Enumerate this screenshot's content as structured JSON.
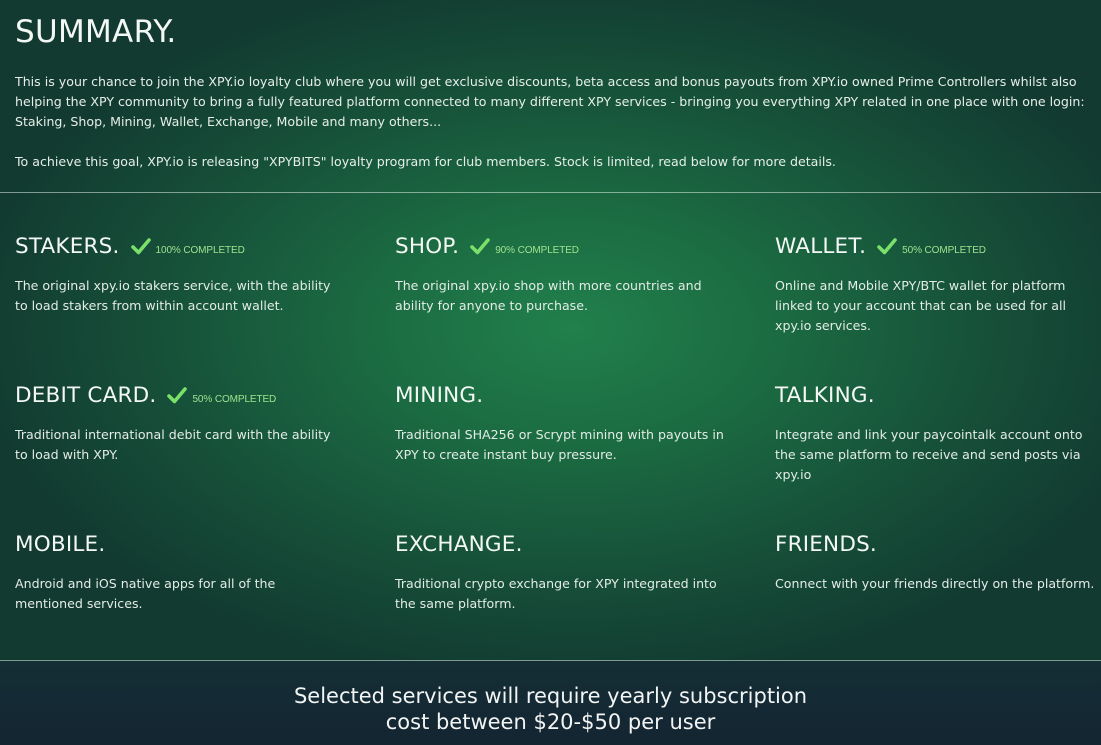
{
  "summary": {
    "title": "SUMMARY.",
    "paragraph1": "This is your chance to join the XPY.io loyalty club where you will get exclusive discounts, beta access and bonus payouts from XPY.io owned Prime Controllers whilst also helping the XPY community to bring a fully featured platform connected to many different XPY services - bringing you everything XPY related in one place with one login: Staking, Shop, Mining, Wallet, Exchange, Mobile and many others...",
    "paragraph2": "To achieve this goal, XPY.io is releasing \"XPYBITS\" loyalty program for club members. Stock is limited, read below for more details."
  },
  "services": [
    {
      "title": "STAKERS.",
      "badge": "100% COMPLETED",
      "progress_percent": 100,
      "icon": "check-icon",
      "description": "The original xpy.io stakers service, with the ability to load stakers from within account wallet."
    },
    {
      "title": "SHOP.",
      "badge": "90% COMPLETED",
      "progress_percent": 90,
      "icon": "check-icon",
      "description": "The original xpy.io shop with more countries and ability for anyone to purchase."
    },
    {
      "title": "WALLET.",
      "badge": "50% COMPLETED",
      "progress_percent": 50,
      "icon": "check-icon",
      "description": "Online and Mobile XPY/BTC wallet for platform linked to your account that can be used for all xpy.io services."
    },
    {
      "title": "DEBIT CARD.",
      "badge": "50% COMPLETED",
      "progress_percent": 50,
      "icon": "check-icon",
      "description": "Traditional international debit card with the ability to load with XPY."
    },
    {
      "title": "MINING.",
      "description": "Traditional SHA256 or Scrypt mining with payouts in XPY to create instant buy pressure."
    },
    {
      "title": "TALKING.",
      "description": "Integrate and link your paycointalk account onto the same platform to receive and send posts via xpy.io"
    },
    {
      "title": "MOBILE.",
      "description": "Android and iOS native apps for all of the mentioned services."
    },
    {
      "title": "EXCHANGE.",
      "description": "Traditional crypto exchange for XPY integrated into the same platform."
    },
    {
      "title": "FRIENDS.",
      "description": "Connect with your friends directly on the platform."
    }
  ],
  "footer": {
    "line1": "Selected services will require yearly subscription",
    "line2": "cost between $20-$50 per user"
  },
  "colors": {
    "background_center": "#21804c",
    "background_edge": "#123a30",
    "badge_green": "#9fe38f",
    "check_green": "#7be06a",
    "footer_bg": "#142a33"
  }
}
